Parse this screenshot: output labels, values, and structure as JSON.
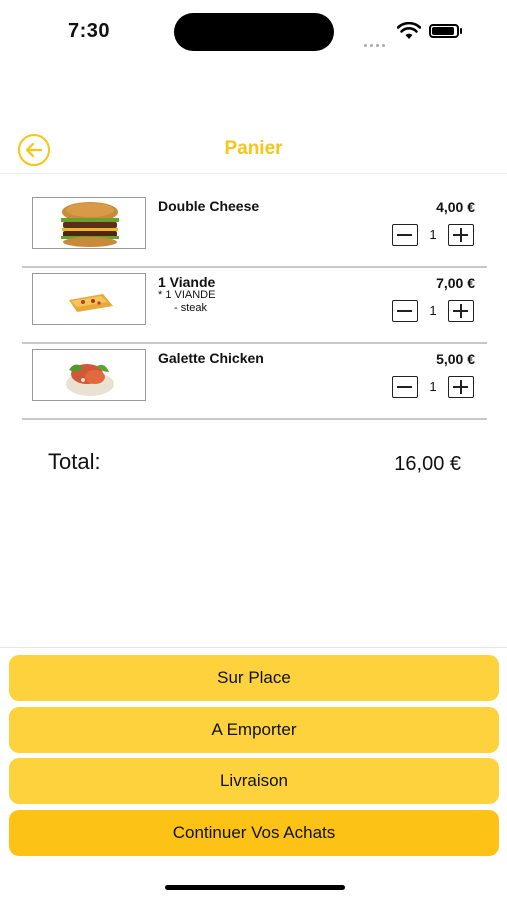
{
  "status": {
    "time": "7:30"
  },
  "nav": {
    "title": "Panier"
  },
  "cart": {
    "items": [
      {
        "name": "Double Cheese",
        "price": "4,00 €",
        "qty": "1",
        "subs": []
      },
      {
        "name": "1 Viande",
        "price": "7,00 €",
        "qty": "1",
        "subs": [
          "* 1 VIANDE",
          "- steak"
        ]
      },
      {
        "name": "Galette Chicken",
        "price": "5,00 €",
        "qty": "1",
        "subs": []
      }
    ],
    "total_label": "Total:",
    "total_value": "16,00 €"
  },
  "actions": {
    "sur_place": "Sur Place",
    "a_emporter": "A Emporter",
    "livraison": "Livraison",
    "continuer": "Continuer Vos Achats"
  },
  "colors": {
    "accent": "#f5c518",
    "button": "#fdd23c",
    "button_primary": "#fcc316"
  },
  "icons": {
    "back": "arrow-left-circle-icon",
    "wifi": "wifi-icon",
    "battery": "battery-icon"
  }
}
